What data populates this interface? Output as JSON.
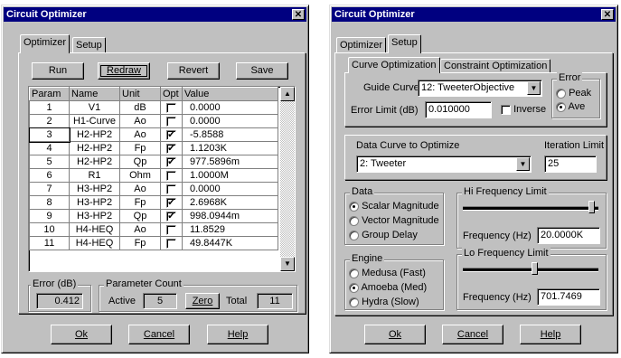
{
  "left": {
    "title": "Circuit Optimizer",
    "tabs": [
      "Optimizer",
      "Setup"
    ],
    "buttons": {
      "run": "Run",
      "redraw": "Redraw",
      "revert": "Revert",
      "save": "Save"
    },
    "columns": [
      "Param",
      "Name",
      "Unit",
      "Opt",
      "Value"
    ],
    "rows": [
      {
        "param": "1",
        "name": "V1",
        "unit": "dB",
        "opt": false,
        "value": "0.0000"
      },
      {
        "param": "2",
        "name": "H1-Curve",
        "unit": "Ao",
        "opt": false,
        "value": "0.0000"
      },
      {
        "param": "3",
        "name": "H2-HP2",
        "unit": "Ao",
        "opt": true,
        "value": "-5.8588"
      },
      {
        "param": "4",
        "name": "H2-HP2",
        "unit": "Fp",
        "opt": true,
        "value": "1.1203K"
      },
      {
        "param": "5",
        "name": "H2-HP2",
        "unit": "Qp",
        "opt": true,
        "value": "977.5896m"
      },
      {
        "param": "6",
        "name": "R1",
        "unit": "Ohm",
        "opt": false,
        "value": "1.0000M"
      },
      {
        "param": "7",
        "name": "H3-HP2",
        "unit": "Ao",
        "opt": false,
        "value": "0.0000"
      },
      {
        "param": "8",
        "name": "H3-HP2",
        "unit": "Fp",
        "opt": true,
        "value": "2.6968K"
      },
      {
        "param": "9",
        "name": "H3-HP2",
        "unit": "Qp",
        "opt": true,
        "value": "998.0944m"
      },
      {
        "param": "10",
        "name": "H4-HEQ",
        "unit": "Ao",
        "opt": false,
        "value": "11.8529"
      },
      {
        "param": "11",
        "name": "H4-HEQ",
        "unit": "Fp",
        "opt": false,
        "value": "49.8447K"
      }
    ],
    "error_label": "Error (dB)",
    "error_value": "0.412",
    "param_count_label": "Parameter Count",
    "active_label": "Active",
    "active_value": "5",
    "zero_label": "Zero",
    "total_label": "Total",
    "total_value": "11",
    "ok": "Ok",
    "cancel": "Cancel",
    "help": "Help"
  },
  "right": {
    "title": "Circuit Optimizer",
    "tabs": [
      "Optimizer",
      "Setup"
    ],
    "subtabs": [
      "Curve Optimization",
      "Constraint Optimization"
    ],
    "guide_curve_label": "Guide Curve",
    "guide_curve_value": "12: TweeterObjective",
    "error_limit_label": "Error Limit (dB)",
    "error_limit_value": "0.010000",
    "inverse_label": "Inverse",
    "error_group": "Error",
    "peak_label": "Peak",
    "ave_label": "Ave",
    "data_curve_label": "Data Curve to Optimize",
    "data_curve_value": "2: Tweeter",
    "iteration_label": "Iteration Limit",
    "iteration_value": "25",
    "data_group": "Data",
    "scalar_label": "Scalar Magnitude",
    "vector_label": "Vector Magnitude",
    "group_delay_label": "Group Delay",
    "hi_freq_label": "Hi Frequency Limit",
    "hi_freq_field_label": "Frequency (Hz)",
    "hi_freq_value": "20.0000K",
    "hi_slider_level": 0.97,
    "engine_group": "Engine",
    "medusa_label": "Medusa (Fast)",
    "amoeba_label": "Amoeba (Med)",
    "hydra_label": "Hydra (Slow)",
    "lo_freq_label": "Lo Frequency Limit",
    "lo_freq_field_label": "Frequency (Hz)",
    "lo_freq_value": "701.7469",
    "lo_slider_level": 0.53,
    "ok": "Ok",
    "cancel": "Cancel",
    "help": "Help"
  }
}
